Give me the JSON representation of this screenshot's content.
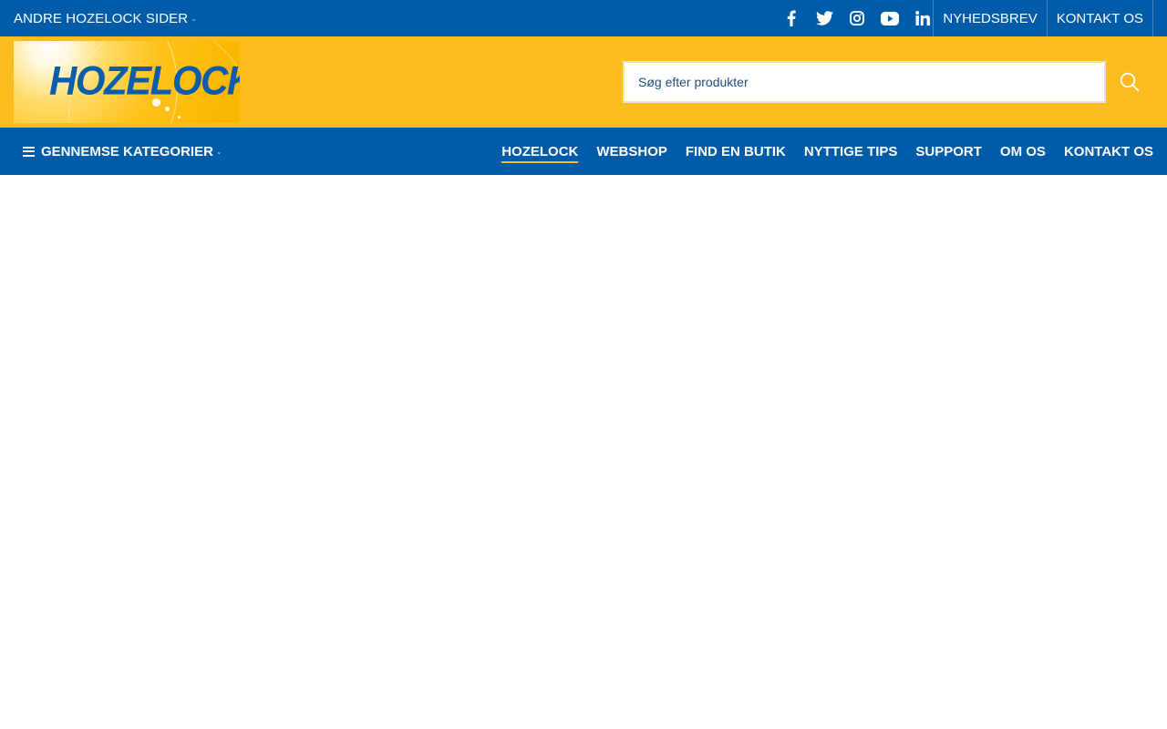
{
  "topbar": {
    "other_sites_label": "ANDRE HOZELOCK SIDER",
    "social_icons": [
      "facebook-icon",
      "twitter-icon",
      "instagram-icon",
      "youtube-icon",
      "linkedin-icon"
    ],
    "links": [
      "NYHEDSBREV",
      "KONTAKT OS"
    ]
  },
  "header": {
    "logo_text": "HOZELOCK",
    "search": {
      "placeholder": "Søg efter produkter",
      "value": ""
    }
  },
  "nav": {
    "categories_label": "GENNEMSE KATEGORIER",
    "items": [
      {
        "label": "HOZELOCK",
        "active": true
      },
      {
        "label": "WEBSHOP",
        "active": false
      },
      {
        "label": "FIND EN BUTIK",
        "active": false
      },
      {
        "label": "NYTTIGE TIPS",
        "active": false
      },
      {
        "label": "SUPPORT",
        "active": false
      },
      {
        "label": "OM OS",
        "active": false
      },
      {
        "label": "KONTAKT OS",
        "active": false
      }
    ]
  },
  "colors": {
    "brand_blue": "#005ca9",
    "brand_yellow": "#fcbb1f",
    "logo_blue": "#0a5cad"
  }
}
